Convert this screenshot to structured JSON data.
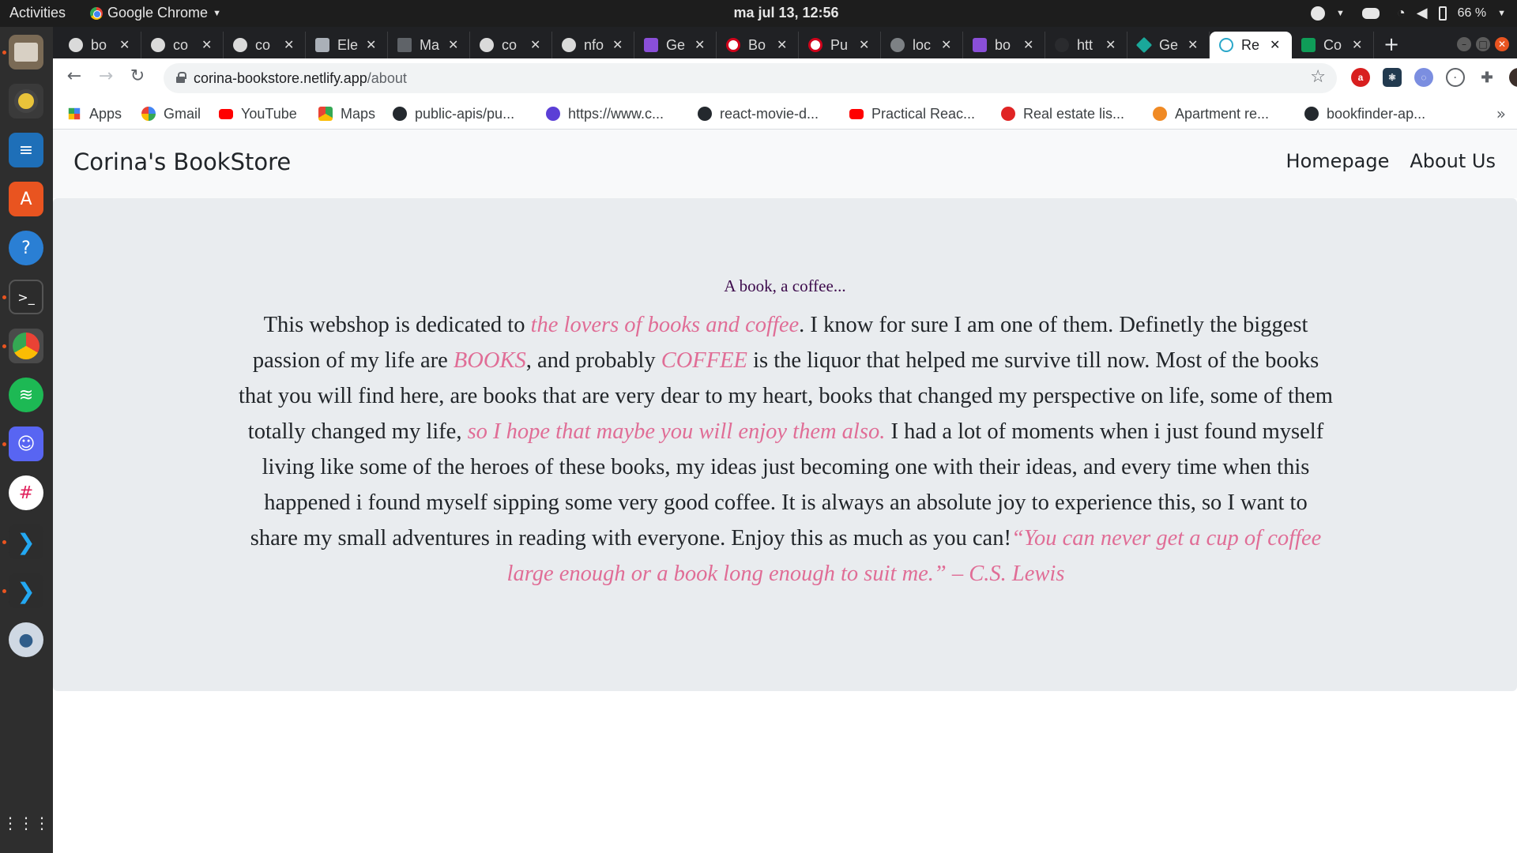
{
  "system_bar": {
    "activities": "Activities",
    "app_name": "Google Chrome",
    "clock": "ma jul 13, 12:56",
    "battery": "66 %"
  },
  "tabs": [
    {
      "label": "bo",
      "favicon": "github-icon"
    },
    {
      "label": "co",
      "favicon": "github-icon"
    },
    {
      "label": "co",
      "favicon": "github-icon"
    },
    {
      "label": "Ele",
      "favicon": "elephant-icon"
    },
    {
      "label": "Ma",
      "favicon": "page-icon"
    },
    {
      "label": "co",
      "favicon": "github-icon"
    },
    {
      "label": "nfo",
      "favicon": "github-icon"
    },
    {
      "label": "Ge",
      "favicon": "h-icon"
    },
    {
      "label": "Bo",
      "favicon": "dev-icon"
    },
    {
      "label": "Pu",
      "favicon": "dev-icon"
    },
    {
      "label": "loc",
      "favicon": "globe-icon"
    },
    {
      "label": "bo",
      "favicon": "h-icon"
    },
    {
      "label": "htt",
      "favicon": "blank-icon"
    },
    {
      "label": "Ge",
      "favicon": "diamond-icon"
    },
    {
      "label": "Re",
      "favicon": "react-icon",
      "active": true
    },
    {
      "label": "Co",
      "favicon": "sheets-icon"
    }
  ],
  "address_bar": {
    "host": "corina-bookstore.netlify.app",
    "path": "/about"
  },
  "bookmarks": [
    {
      "label": "Apps",
      "icon": "apps-grid-icon"
    },
    {
      "label": "Gmail",
      "icon": "google-icon"
    },
    {
      "label": "YouTube",
      "icon": "youtube-icon"
    },
    {
      "label": "Maps",
      "icon": "maps-icon"
    },
    {
      "label": "public-apis/pu...",
      "icon": "github-icon"
    },
    {
      "label": "https://www.c...",
      "icon": "c-icon"
    },
    {
      "label": "react-movie-d...",
      "icon": "github-icon"
    },
    {
      "label": "Practical Reac...",
      "icon": "youtube-icon"
    },
    {
      "label": "Real estate lis...",
      "icon": "realestate-icon"
    },
    {
      "label": "Apartment re...",
      "icon": "apartment-icon"
    },
    {
      "label": "bookfinder-ap...",
      "icon": "github-icon"
    }
  ],
  "site": {
    "brand": "Corina's BookStore",
    "nav": {
      "home": "Homepage",
      "about": "About Us"
    },
    "subtitle": "A book, a coffee...",
    "about": {
      "t1": "This webshop is dedicated to ",
      "h1": "the lovers of books and coffee",
      "t2": ". I know for sure I am one of them. Definetly the biggest passion of my life are ",
      "h2": "BOOKS",
      "t3": ", and probably ",
      "h3": "COFFEE",
      "t4": " is the liquor that helped me survive till now. Most of the books that you will find here, are books that are very dear to my heart, books that changed my perspective on life, some of them totally changed my life, ",
      "h4": "so I hope that maybe you will enjoy them also.",
      "t5": " I had a lot of moments when i just found myself living like some of the heroes of these books, my ideas just becoming one with their ideas, and every time when this happened i found myself sipping some very good coffee. It is always an absolute joy to experience this, so I want to share my small adventures in reading with everyone. Enjoy this as much as you can!",
      "quote": "“You can never get a cup of coffee large enough or a book long enough to suit me.” – C.S. Lewis"
    },
    "colors": {
      "highlight": "#e06d96",
      "subtitle": "#3c0a4b",
      "section_bg": "#e9ecef"
    }
  }
}
